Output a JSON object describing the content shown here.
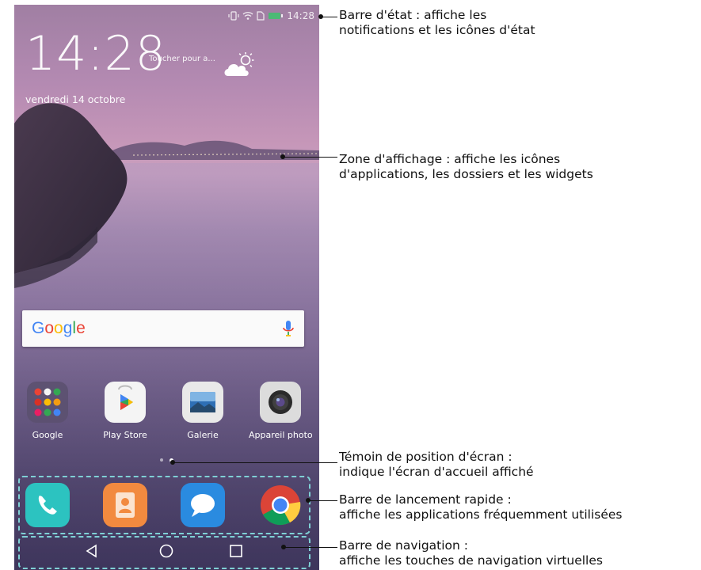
{
  "status_bar": {
    "time": "14:28",
    "icons": [
      "vibrate-icon",
      "wifi-icon",
      "no-sim-icon",
      "battery-icon"
    ]
  },
  "lock_widget": {
    "clock": "14:28",
    "weather_hint": "Toucher pour a...",
    "date": "vendredi 14 octobre",
    "weather_icon": "partly-sunny-icon"
  },
  "search": {
    "logo": "Google",
    "mic_icon": "mic-icon"
  },
  "apps": [
    {
      "label": "Google",
      "icon": "google-folder-icon"
    },
    {
      "label": "Play Store",
      "icon": "play-store-icon"
    },
    {
      "label": "Galerie",
      "icon": "gallery-icon"
    },
    {
      "label": "Appareil photo",
      "icon": "camera-icon"
    }
  ],
  "page_indicator": {
    "count": 2,
    "active": 2
  },
  "dock": [
    {
      "icon": "phone-icon",
      "color": "#2cc3c0"
    },
    {
      "icon": "contacts-icon",
      "color": "#f28a3f"
    },
    {
      "icon": "messages-icon",
      "color": "#2a8be0"
    },
    {
      "icon": "chrome-icon",
      "color": "#db4437"
    }
  ],
  "nav": {
    "keys": [
      "back-icon",
      "home-icon",
      "recents-icon"
    ]
  },
  "callouts": {
    "status_bar": {
      "line1": "Barre d'état : affiche les",
      "line2": "notifications et les icônes d'état"
    },
    "display_area": {
      "line1": "Zone d'affichage : affiche les icônes",
      "line2": "d'applications, les dossiers et les widgets"
    },
    "screen_position": {
      "line1": "Témoin de position d'écran :",
      "line2": "indique l'écran d'accueil affiché"
    },
    "quick_launch": {
      "line1": "Barre de lancement rapide :",
      "line2": "affiche les applications fréquemment utilisées"
    },
    "navigation": {
      "line1": "Barre de navigation :",
      "line2": "affiche les touches de navigation virtuelles"
    }
  },
  "colors": {
    "dashed_frame": "#7fd0d5",
    "wallpaper_top": "#a07fa3",
    "wallpaper_bottom": "#3a3457"
  }
}
